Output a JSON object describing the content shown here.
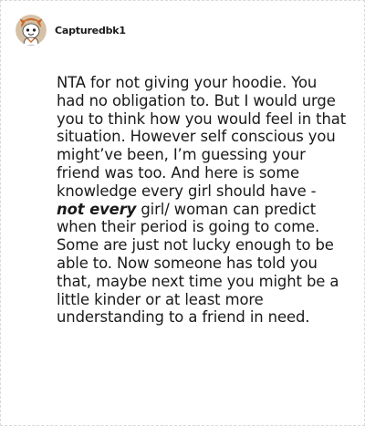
{
  "comment": {
    "username": "Capturedbk1",
    "avatar_icon": "snoo-avatar-icon",
    "text_before": "NTA for not giving your hoodie. You had no obligation to. But I would urge you to think how you would feel in that situation. However self conscious you might’ve been, I’m guessing your friend was too. And here is some knowledge every girl should have - ",
    "text_emphasis": "not every",
    "text_after": " girl/ woman can predict when their period is going to come. Some are just not lucky enough to be able to. Now someone has told you that, maybe next time you might be a little kinder or at least more understanding to a friend in need."
  },
  "colors": {
    "background": "#ffffff",
    "text": "#1a1a1a",
    "border": "#d9d9d9",
    "avatar_bg": "#d6c1a6",
    "avatar_accent": "#c96a2b"
  }
}
